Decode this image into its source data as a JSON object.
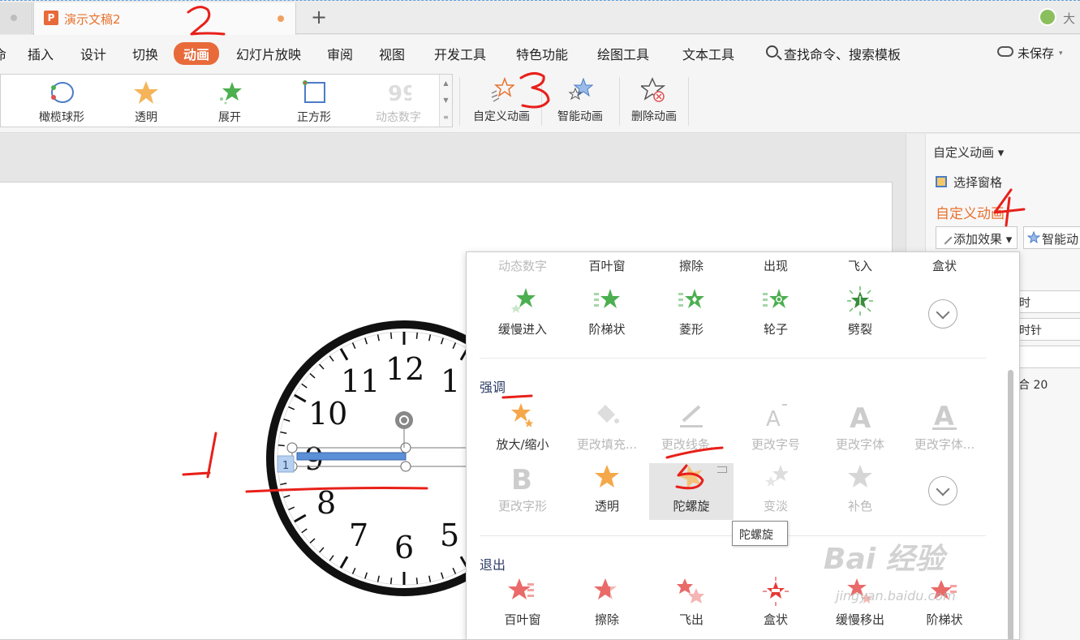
{
  "titlebar": {
    "doc_title": "演示文稿2",
    "app_icon_letter": "P",
    "new_tab_symbol": "+",
    "user_label": "大"
  },
  "menu": {
    "items": [
      {
        "label": "插入"
      },
      {
        "label": "设计"
      },
      {
        "label": "切换"
      },
      {
        "label": "动画"
      },
      {
        "label": "幻灯片放映"
      },
      {
        "label": "审阅"
      },
      {
        "label": "视图"
      },
      {
        "label": "开发工具"
      },
      {
        "label": "特色功能"
      },
      {
        "label": "绘图工具"
      },
      {
        "label": "文本工具"
      }
    ],
    "left_fragment": "命",
    "search_label": "查找命令、搜索模板",
    "save_status": "未保存",
    "save_caret": "▾"
  },
  "ribbon": {
    "gallery": [
      {
        "label": "橄榄球形"
      },
      {
        "label": "透明"
      },
      {
        "label": "展开"
      },
      {
        "label": "正方形"
      },
      {
        "label": "动态数字"
      }
    ],
    "left_fragment": "转",
    "custom_animation": "自定义动画",
    "smart_animation": "智能动画",
    "delete_animation": "删除动画"
  },
  "taskpane": {
    "title": "自定义动画",
    "select_pane": "选择窗格",
    "heading": "自定义动画",
    "add_effect": "添加效果",
    "smart_animation": "智能动",
    "field1": "时",
    "field2": "时针",
    "field3": "",
    "field4": "合 20"
  },
  "dropdown": {
    "top_labels": [
      "动态数字",
      "百叶窗",
      "擦除",
      "出现",
      "飞入",
      "盒状"
    ],
    "entrance_items": [
      "缓慢进入",
      "阶梯状",
      "菱形",
      "轮子",
      "劈裂"
    ],
    "emphasis_title": "强调",
    "emphasis_row1": [
      "放大/缩小",
      "更改填充...",
      "更改线条...",
      "更改字号",
      "更改字体",
      "更改字体..."
    ],
    "emphasis_row2": [
      "更改字形",
      "透明",
      "陀螺旋",
      "变淡",
      "补色"
    ],
    "exit_title": "退出",
    "exit_items": [
      "百叶窗",
      "擦除",
      "飞出",
      "盒状",
      "缓慢移出",
      "阶梯状"
    ]
  },
  "tooltip": "陀螺旋",
  "slide": {
    "clock_numbers": [
      "12",
      "11",
      "1",
      "10",
      "9",
      "8",
      "7",
      "6",
      "5"
    ],
    "anim_tag": "1"
  },
  "annotations": [
    "1",
    "2",
    "3",
    "4",
    "5"
  ],
  "watermark": {
    "text": "Bai 经验",
    "url": "jingyan.baidu.com"
  },
  "colors": {
    "accent": "#e86a3a",
    "annotation_red": "#e8201a",
    "emphasis_star": "#f5a84a",
    "entrance_star": "#4caf50",
    "exit_star": "#ea6a6a"
  }
}
